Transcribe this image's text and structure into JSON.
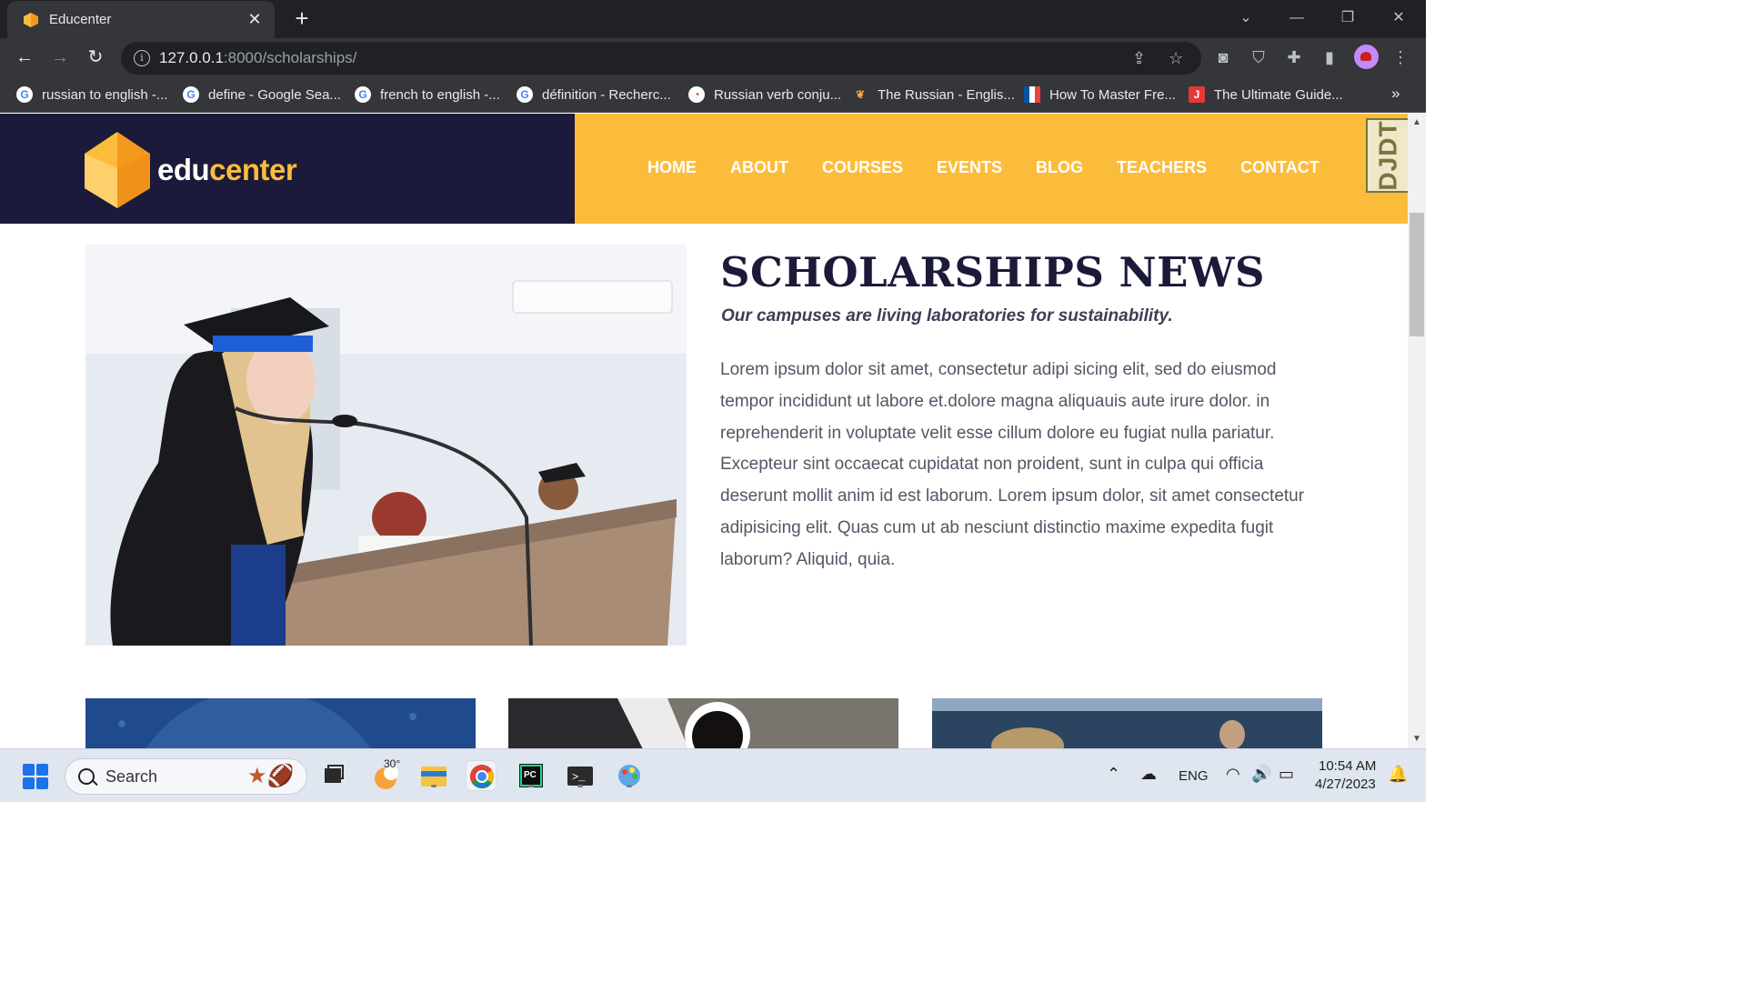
{
  "browser": {
    "tab_title": "Educenter",
    "url_host": "127.0.0.1",
    "url_path": ":8000/scholarships/",
    "bookmarks": [
      {
        "label": "russian to english -...",
        "icon": "google-icon"
      },
      {
        "label": "define - Google Sea...",
        "icon": "google-icon"
      },
      {
        "label": "french to english -...",
        "icon": "google-icon"
      },
      {
        "label": "définition - Recherc...",
        "icon": "google-icon"
      },
      {
        "label": "Russian verb conju...",
        "icon": "reverso-icon"
      },
      {
        "label": "The Russian - Englis...",
        "icon": "flag-ru-icon"
      },
      {
        "label": "How To Master Fre...",
        "icon": "flag-fr-icon"
      },
      {
        "label": "The Ultimate Guide...",
        "icon": "j-icon"
      }
    ],
    "bookmarks_overflow": "»"
  },
  "site": {
    "logo_edu": "edu",
    "logo_center": "center",
    "nav": [
      "HOME",
      "ABOUT",
      "COURSES",
      "EVENTS",
      "BLOG",
      "TEACHERS",
      "CONTACT"
    ],
    "djdt_label": "DJDT",
    "colors": {
      "header_dark": "#1b1a3a",
      "header_yellow": "#fcbc3b",
      "title": "#1b1a3a"
    }
  },
  "content": {
    "title": "SCHOLARSHIPS NEWS",
    "subtitle": "Our campuses are living laboratories for sustainability.",
    "body": "Lorem ipsum dolor sit amet, consectetur adipi sicing elit, sed do eiusmod tempor incididunt ut labore et.dolore magna aliquauis aute irure dolor. in reprehenderit in voluptate velit esse cillum dolore eu fugiat nulla pariatur. Excepteur sint occaecat cupidatat non proident, sunt in culpa qui officia deserunt mollit anim id est laborum. Lorem ipsum dolor, sit amet consectetur adipisicing elit. Quas cum ut ab nesciunt distinctio maxime expedita fugit laborum? Aliquid, quia."
  },
  "taskbar": {
    "search_label": "Search",
    "weather_temp": "30°",
    "language": "ENG",
    "time": "10:54 AM",
    "date": "4/27/2023"
  }
}
